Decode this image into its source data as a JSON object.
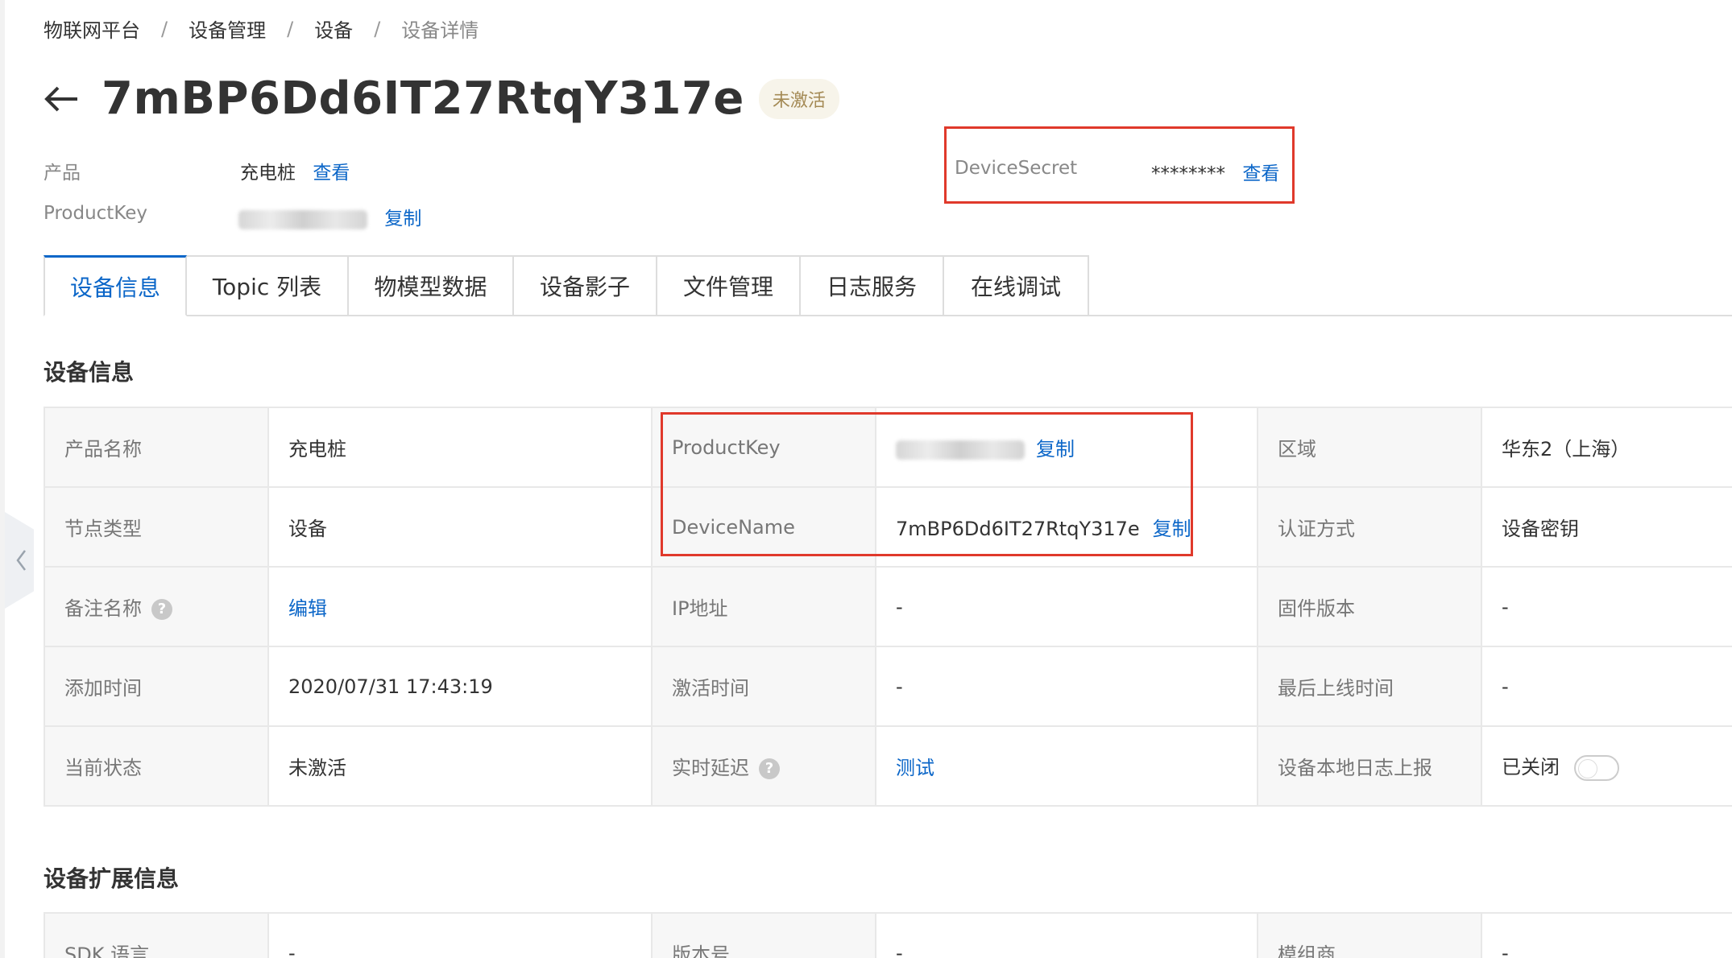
{
  "breadcrumb": [
    "物联网平台",
    "设备管理",
    "设备",
    "设备详情"
  ],
  "breadcrumb_separator": "/",
  "title": "7mBP6Dd6IT27RtqY317e",
  "status_tag": "未激活",
  "meta": {
    "product_label": "产品",
    "product_value": "充电桩",
    "product_view_link": "查看",
    "productkey_label": "ProductKey",
    "productkey_copy_link": "复制",
    "devicesecret_label": "DeviceSecret",
    "devicesecret_value": "********",
    "devicesecret_view_link": "查看"
  },
  "tabs": [
    "设备信息",
    "Topic 列表",
    "物模型数据",
    "设备影子",
    "文件管理",
    "日志服务",
    "在线调试"
  ],
  "active_tab": 0,
  "device_info": {
    "title": "设备信息",
    "rows": [
      [
        {
          "label": "产品名称",
          "value": "充电桩"
        },
        {
          "label": "ProductKey",
          "value": "",
          "link": "复制"
        },
        {
          "label": "区域",
          "value": "华东2（上海）"
        }
      ],
      [
        {
          "label": "节点类型",
          "value": "设备"
        },
        {
          "label": "DeviceName",
          "value": "7mBP6Dd6IT27RtqY317e",
          "link": "复制"
        },
        {
          "label": "认证方式",
          "value": "设备密钥"
        }
      ],
      [
        {
          "label": "备注名称",
          "value": "",
          "link": "编辑"
        },
        {
          "label": "IP地址",
          "value": "-"
        },
        {
          "label": "固件版本",
          "value": "-"
        }
      ],
      [
        {
          "label": "添加时间",
          "value": "2020/07/31 17:43:19"
        },
        {
          "label": "激活时间",
          "value": "-"
        },
        {
          "label": "最后上线时间",
          "value": "-"
        }
      ],
      [
        {
          "label": "当前状态",
          "value": "未激活"
        },
        {
          "label": "实时延迟",
          "value": "",
          "link": "测试"
        },
        {
          "label": "设备本地日志上报",
          "value": "已关闭"
        }
      ]
    ],
    "help_icon": "?"
  },
  "extended_info": {
    "title": "设备扩展信息",
    "row": [
      {
        "label": "SDK 语言",
        "value": "-"
      },
      {
        "label": "版本号",
        "value": "-"
      },
      {
        "label": "模组商",
        "value": "-"
      }
    ]
  },
  "colors": {
    "link": "#0b66c8",
    "highlight_box": "#e0392b",
    "status_tag_bg": "#f7f4ea",
    "status_tag_text": "#a48a55"
  }
}
